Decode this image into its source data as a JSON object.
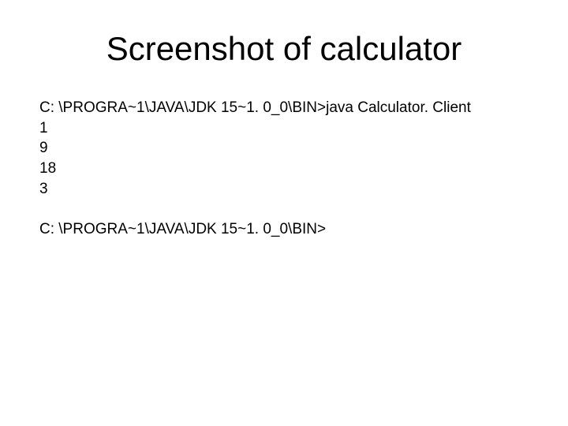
{
  "title": "Screenshot of calculator",
  "terminal": {
    "block1": {
      "line1": "C: \\PROGRA~1\\JAVA\\JDK 15~1. 0_0\\BIN>java Calculator. Client",
      "line2": "1",
      "line3": "9",
      "line4": "18",
      "line5": "3"
    },
    "block2": {
      "line1": "C: \\PROGRA~1\\JAVA\\JDK 15~1. 0_0\\BIN>"
    }
  }
}
